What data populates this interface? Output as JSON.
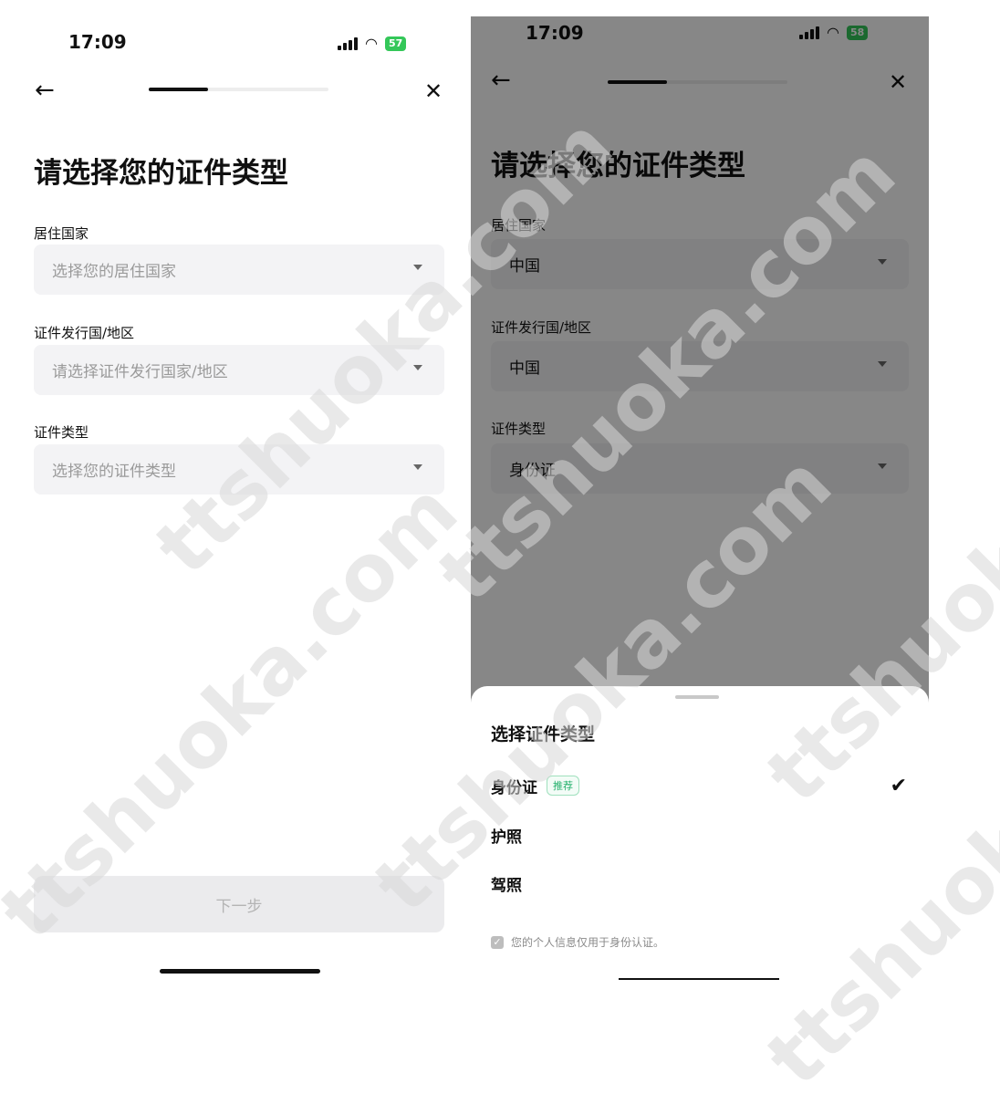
{
  "left": {
    "status": {
      "time": "17:09",
      "battery": "57"
    },
    "title": "请选择您的证件类型",
    "fields": [
      {
        "label": "居住国家",
        "placeholder": "选择您的居住国家"
      },
      {
        "label": "证件发行国/地区",
        "placeholder": "请选择证件发行国家/地区"
      },
      {
        "label": "证件类型",
        "placeholder": "选择您的证件类型"
      }
    ],
    "next_button": "下一步",
    "progress": 0.33
  },
  "right": {
    "status": {
      "time": "17:09",
      "battery": "58"
    },
    "title": "请选择您的证件类型",
    "fields": [
      {
        "label": "居住国家",
        "value": "中国"
      },
      {
        "label": "证件发行国/地区",
        "value": "中国"
      },
      {
        "label": "证件类型",
        "value": "身份证"
      }
    ],
    "progress": 0.33,
    "sheet": {
      "title": "选择证件类型",
      "options": [
        {
          "label": "身份证",
          "badge": "推荐",
          "selected": true
        },
        {
          "label": "护照"
        },
        {
          "label": "驾照"
        }
      ],
      "consent": "您的个人信息仅用于身份认证。"
    }
  },
  "watermark": "ttshuoka.com",
  "colors": {
    "accent_green": "#34c759",
    "badge_green": "#23b06b"
  }
}
